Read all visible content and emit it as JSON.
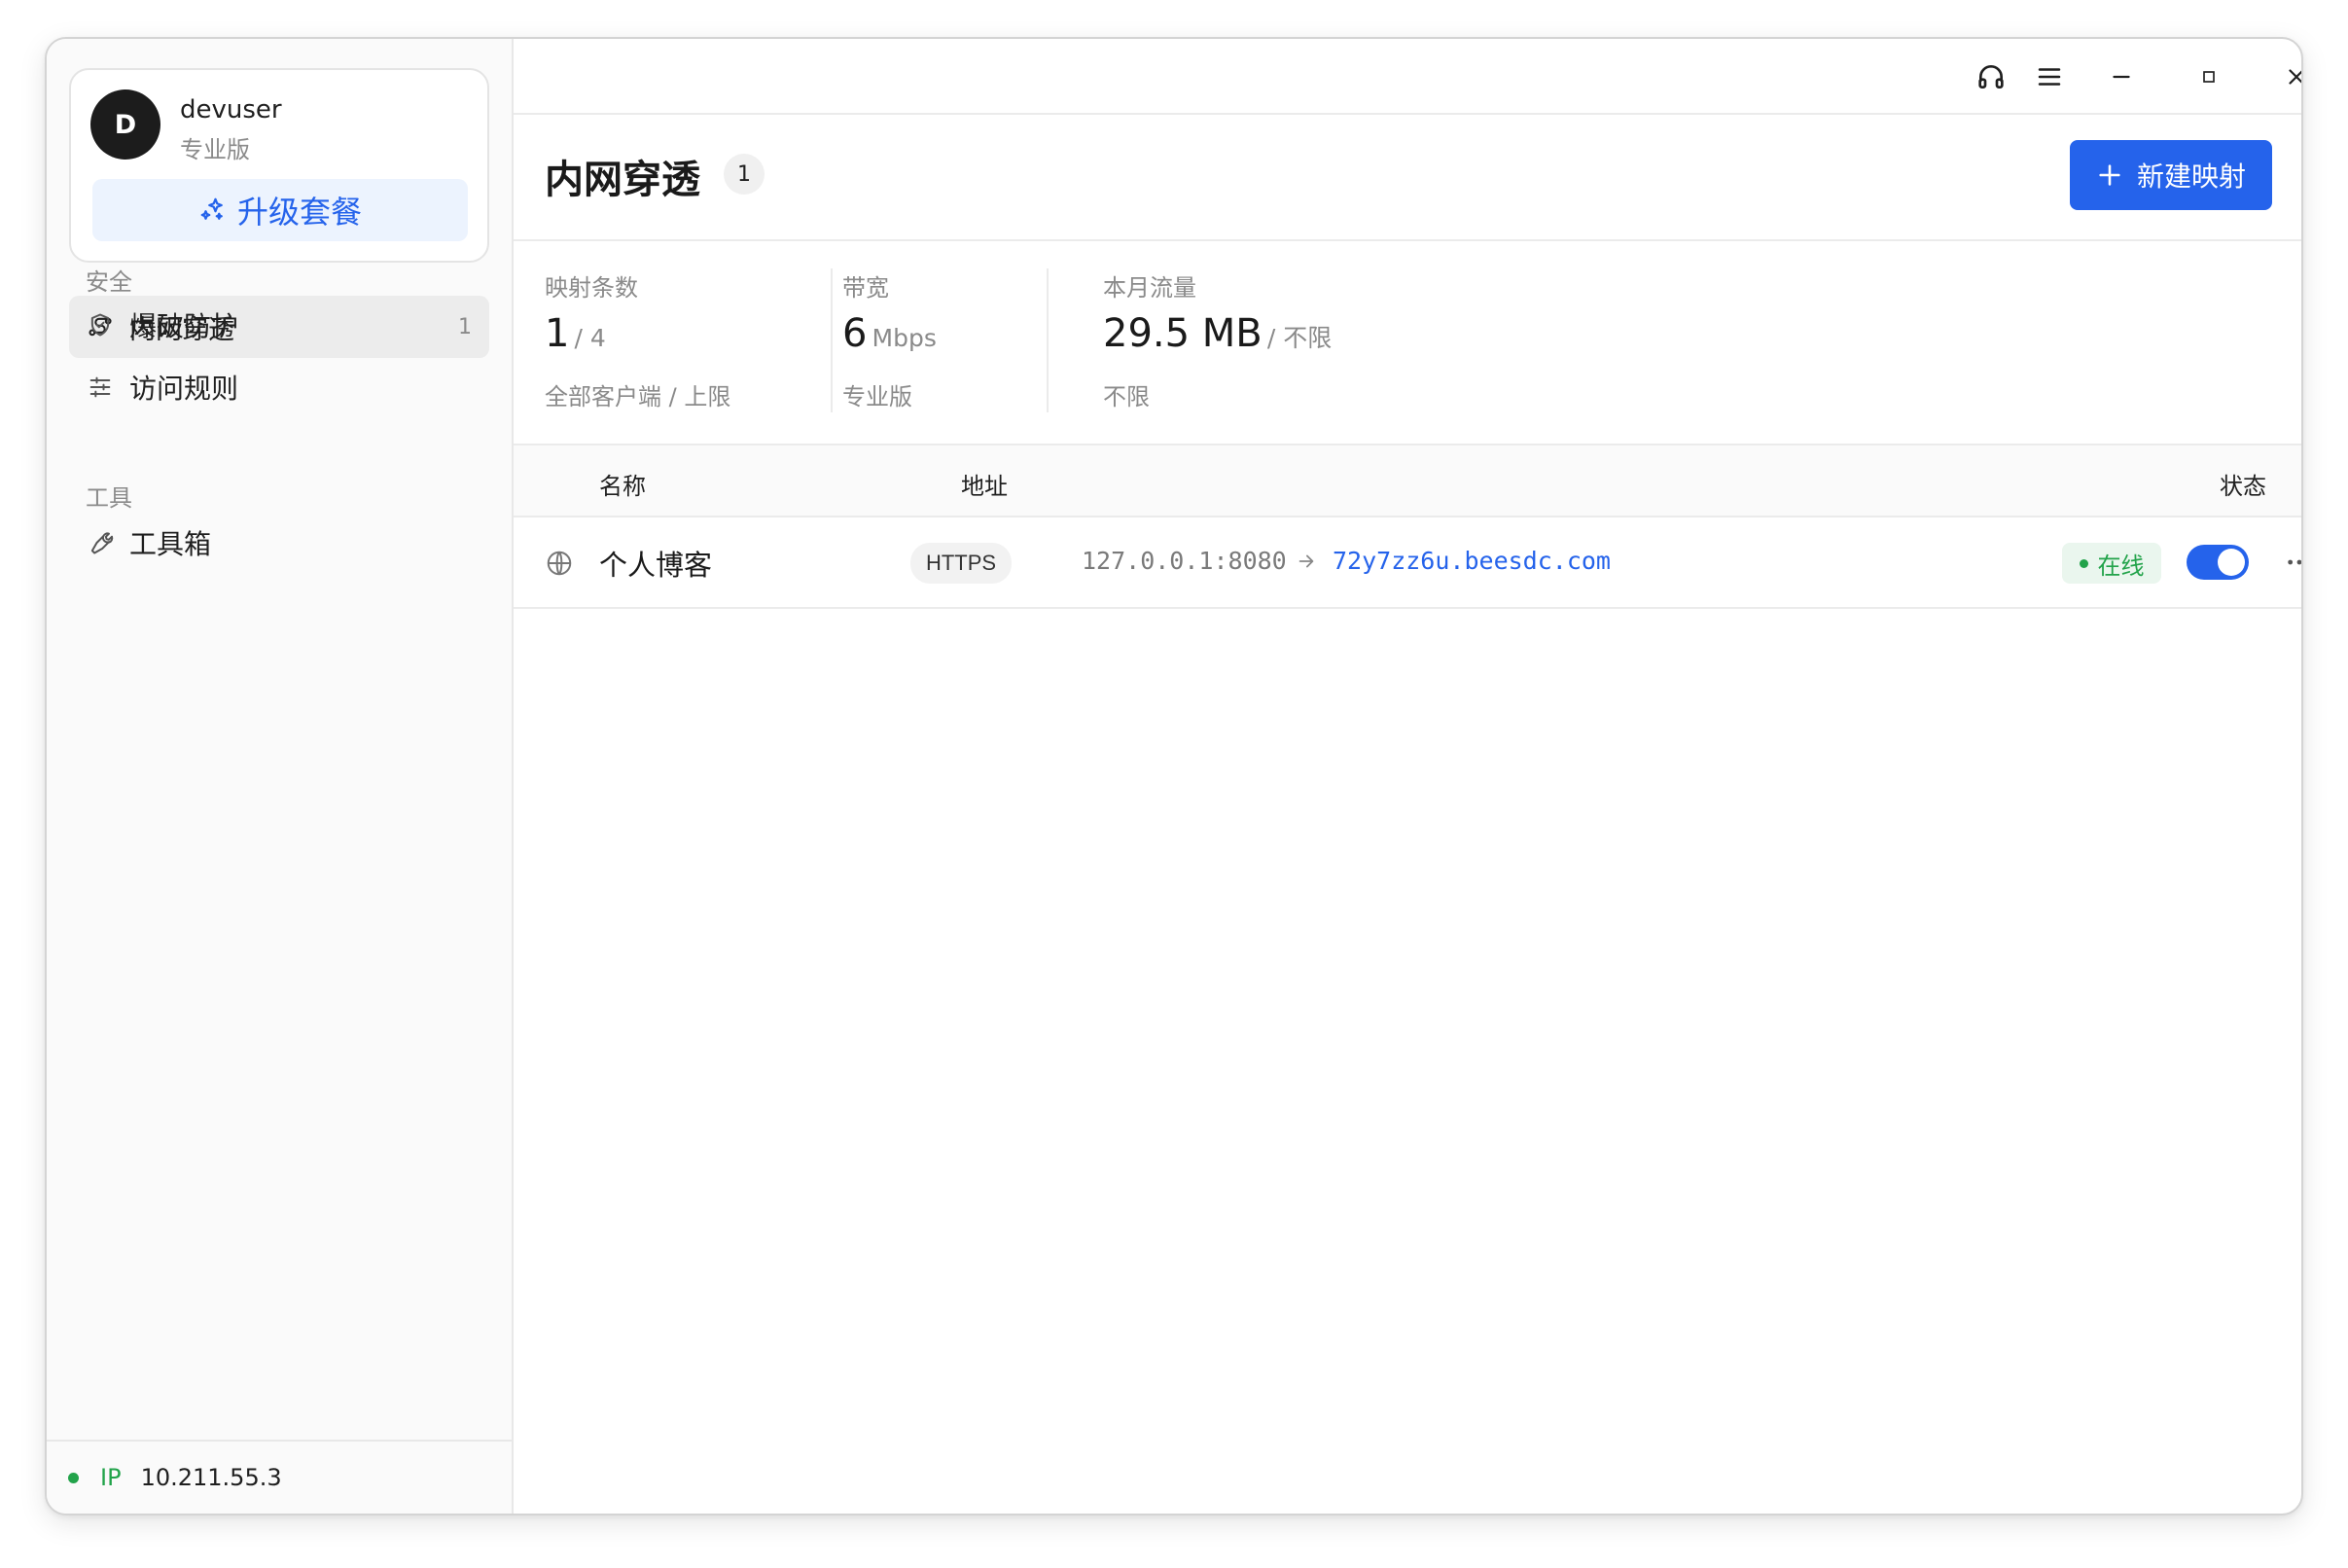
{
  "user": {
    "avatar_letter": "D",
    "name": "devuser",
    "plan": "专业版",
    "upgrade_label": "升级套餐"
  },
  "sidebar": {
    "active_item": {
      "label": "内网穿透",
      "count": "1"
    },
    "sections": [
      {
        "title": "安全",
        "items": [
          {
            "label": "爆破防护",
            "icon": "shield-icon"
          },
          {
            "label": "访问规则",
            "icon": "sliders-icon"
          }
        ]
      },
      {
        "title": "工具",
        "items": [
          {
            "label": "工具箱",
            "icon": "wrench-icon"
          }
        ]
      }
    ],
    "footer": {
      "ip_label": "IP",
      "ip_value": "10.211.55.3"
    }
  },
  "header": {
    "title": "内网穿透",
    "count": "1",
    "new_button_label": "新建映射"
  },
  "stats": [
    {
      "label": "映射条数",
      "value": "1",
      "suffix": "/ 4",
      "sub": "全部客户端 / 上限"
    },
    {
      "label": "带宽",
      "value": "6",
      "suffix": "Mbps",
      "sub": "专业版"
    },
    {
      "label": "本月流量",
      "value": "29.5 MB",
      "suffix": "/ 不限",
      "sub": "不限"
    }
  ],
  "table": {
    "headers": {
      "name": "名称",
      "address": "地址",
      "status": "状态"
    },
    "rows": [
      {
        "name": "个人博客",
        "protocol": "HTTPS",
        "local": "127.0.0.1:8080",
        "remote": "72y7zz6u.beesdc.com",
        "status": "在线",
        "enabled": true
      }
    ]
  },
  "colors": {
    "accent": "#2563eb",
    "online": "#22a34a",
    "muted": "#8a8a8a"
  }
}
